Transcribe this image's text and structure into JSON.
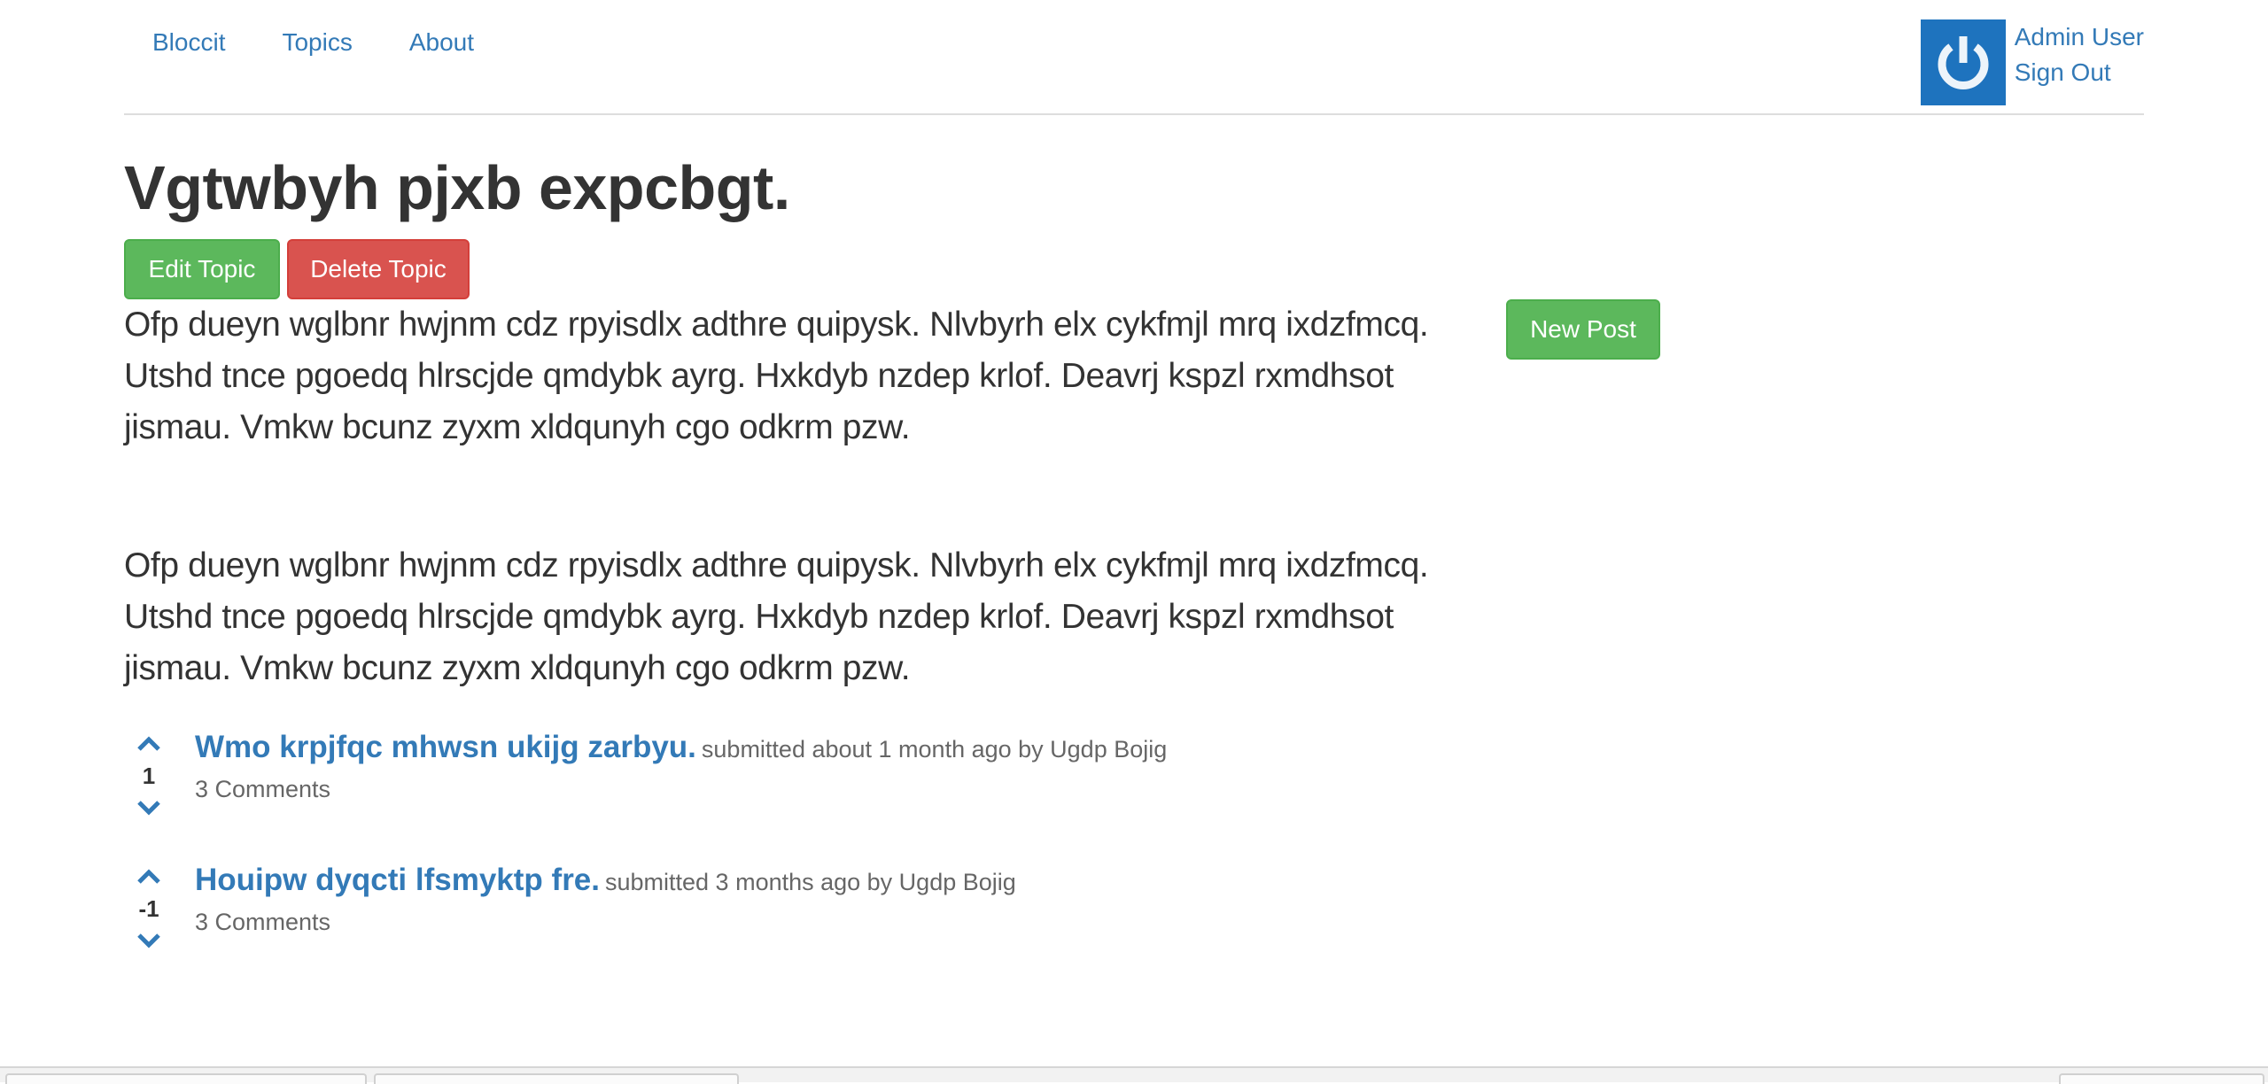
{
  "nav": {
    "brand": "Bloccit",
    "topics": "Topics",
    "about": "About"
  },
  "user": {
    "name": "Admin User",
    "sign_out": "Sign Out",
    "avatar_icon": "power-icon",
    "avatar_color": "#1e73be"
  },
  "topic": {
    "title": "Vgtwbyh pjxb expcbgt.",
    "edit_label": "Edit Topic",
    "delete_label": "Delete Topic",
    "new_post_label": "New Post",
    "description": "Ofp dueyn wglbnr hwjnm cdz rpyisdlx adthre quipysk. Nlvbyrh elx cykfmjl mrq ixdzfmcq. Utshd tnce pgoedq hlrscjde qmdybk ayrg. Hxkdyb nzdep krlof. Deavrj kspzl rxmdhsot jismau. Vmkw bcunz zyxm xldqunyh cgo odkrm pzw.",
    "description_repeat": "Ofp dueyn wglbnr hwjnm cdz rpyisdlx adthre quipysk. Nlvbyrh elx cykfmjl mrq ixdzfmcq. Utshd tnce pgoedq hlrscjde qmdybk ayrg. Hxkdyb nzdep krlof. Deavrj kspzl rxmdhsot jismau. Vmkw bcunz zyxm xldqunyh cgo odkrm pzw."
  },
  "posts": [
    {
      "title": "Wmo krpjfqc mhwsn ukijg zarbyu.",
      "meta": "submitted about 1 month ago by Ugdp Bojig",
      "votes": "1",
      "comments": "3 Comments"
    },
    {
      "title": "Houipw dyqcti lfsmyktp fre.",
      "meta": "submitted 3 months ago by Ugdp Bojig",
      "votes": "-1",
      "comments": "3 Comments"
    }
  ],
  "colors": {
    "link": "#337ab7",
    "success": "#5cb85c",
    "danger": "#d9534f"
  }
}
